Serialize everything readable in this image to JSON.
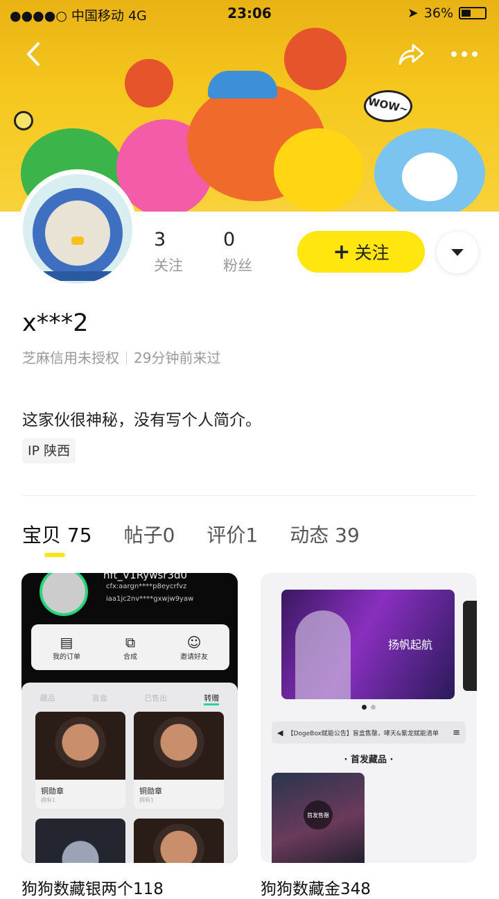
{
  "status_bar": {
    "carrier": "●●●●○ 中国移动  4G",
    "time": "23:06",
    "battery": "36%"
  },
  "banner_art_text": "WOW~",
  "profile": {
    "following_count": "3",
    "following_label": "关注",
    "fans_count": "0",
    "fans_label": "粉丝",
    "follow_button": "关注",
    "username": "x***2",
    "credit": "芝麻信用未授权",
    "last_seen": "29分钟前来过",
    "bio": "这家伙很神秘，没有写个人简介。",
    "ip": "IP 陕西"
  },
  "tabs": [
    {
      "label": "宝贝",
      "count": "75"
    },
    {
      "label": "帖子",
      "count": "0"
    },
    {
      "label": "评价",
      "count": "1"
    },
    {
      "label": "动态",
      "count": "39"
    }
  ],
  "cards": [
    {
      "title": "狗狗数藏银两个118",
      "screenshot": {
        "user": "nft_V1Rywsr3d0",
        "addr1": "cfx:aargn****p8eycrfvz",
        "addr2": "iaa1jc2nv****gxwjw9yaw",
        "menu": [
          "我的订单",
          "合成",
          "邀请好友"
        ],
        "subtabs": [
          "藏品",
          "盲盒",
          "已售出",
          "转赠"
        ],
        "items": [
          {
            "name": "铜勋章",
            "sub": "拥有1"
          },
          {
            "name": "铜勋章",
            "sub": "拥有1"
          }
        ]
      }
    },
    {
      "title": "狗狗数藏金348",
      "screenshot": {
        "banner_text": "扬帆起航",
        "notice": "【DogeBox赋能公告】盲盒售罄，哮天&紫龙赋能清单",
        "section": "· 首发藏品 ·",
        "badge": "首发售罄"
      }
    }
  ],
  "colors": {
    "accent": "#ffe60f",
    "banner": "#f6c81e"
  }
}
